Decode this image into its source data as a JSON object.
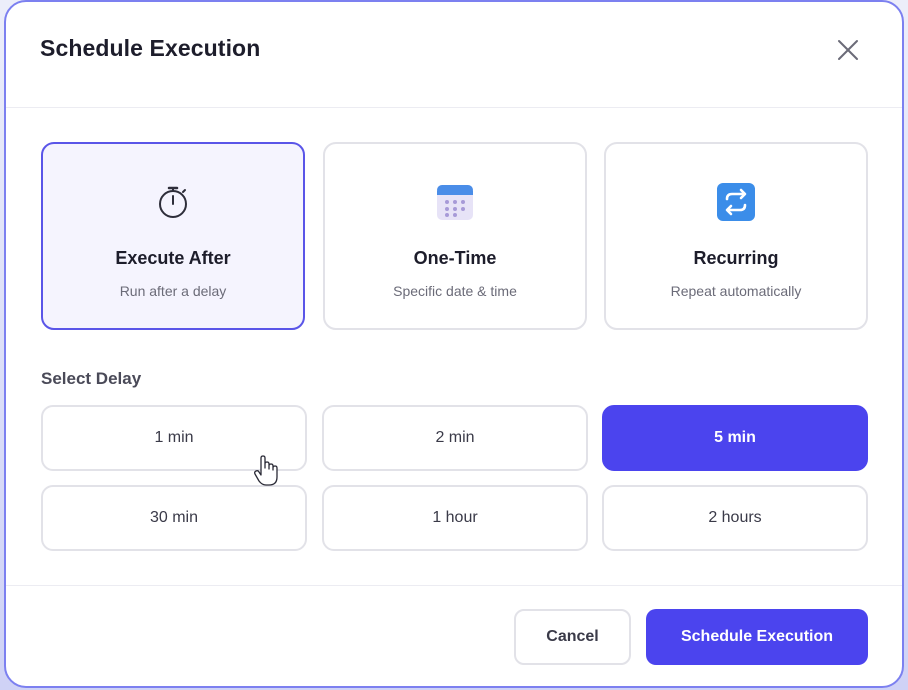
{
  "dialog": {
    "title": "Schedule Execution",
    "close_icon": "close-icon"
  },
  "schedule_types": [
    {
      "label": "Execute After",
      "description": "Run after a delay",
      "icon": "stopwatch-icon",
      "selected": true
    },
    {
      "label": "One-Time",
      "description": "Specific date & time",
      "icon": "calendar-icon",
      "selected": false
    },
    {
      "label": "Recurring",
      "description": "Repeat automatically",
      "icon": "repeat-icon",
      "selected": false
    }
  ],
  "delay": {
    "label": "Select Delay",
    "options": [
      "1 min",
      "2 min",
      "5 min",
      "30 min",
      "1 hour",
      "2 hours"
    ],
    "selected": "5 min"
  },
  "footer": {
    "cancel_label": "Cancel",
    "submit_label": "Schedule Execution"
  },
  "colors": {
    "accent": "#4b44ee",
    "selected_card_border": "#5a55e8",
    "selected_card_bg": "#f5f4fe"
  }
}
